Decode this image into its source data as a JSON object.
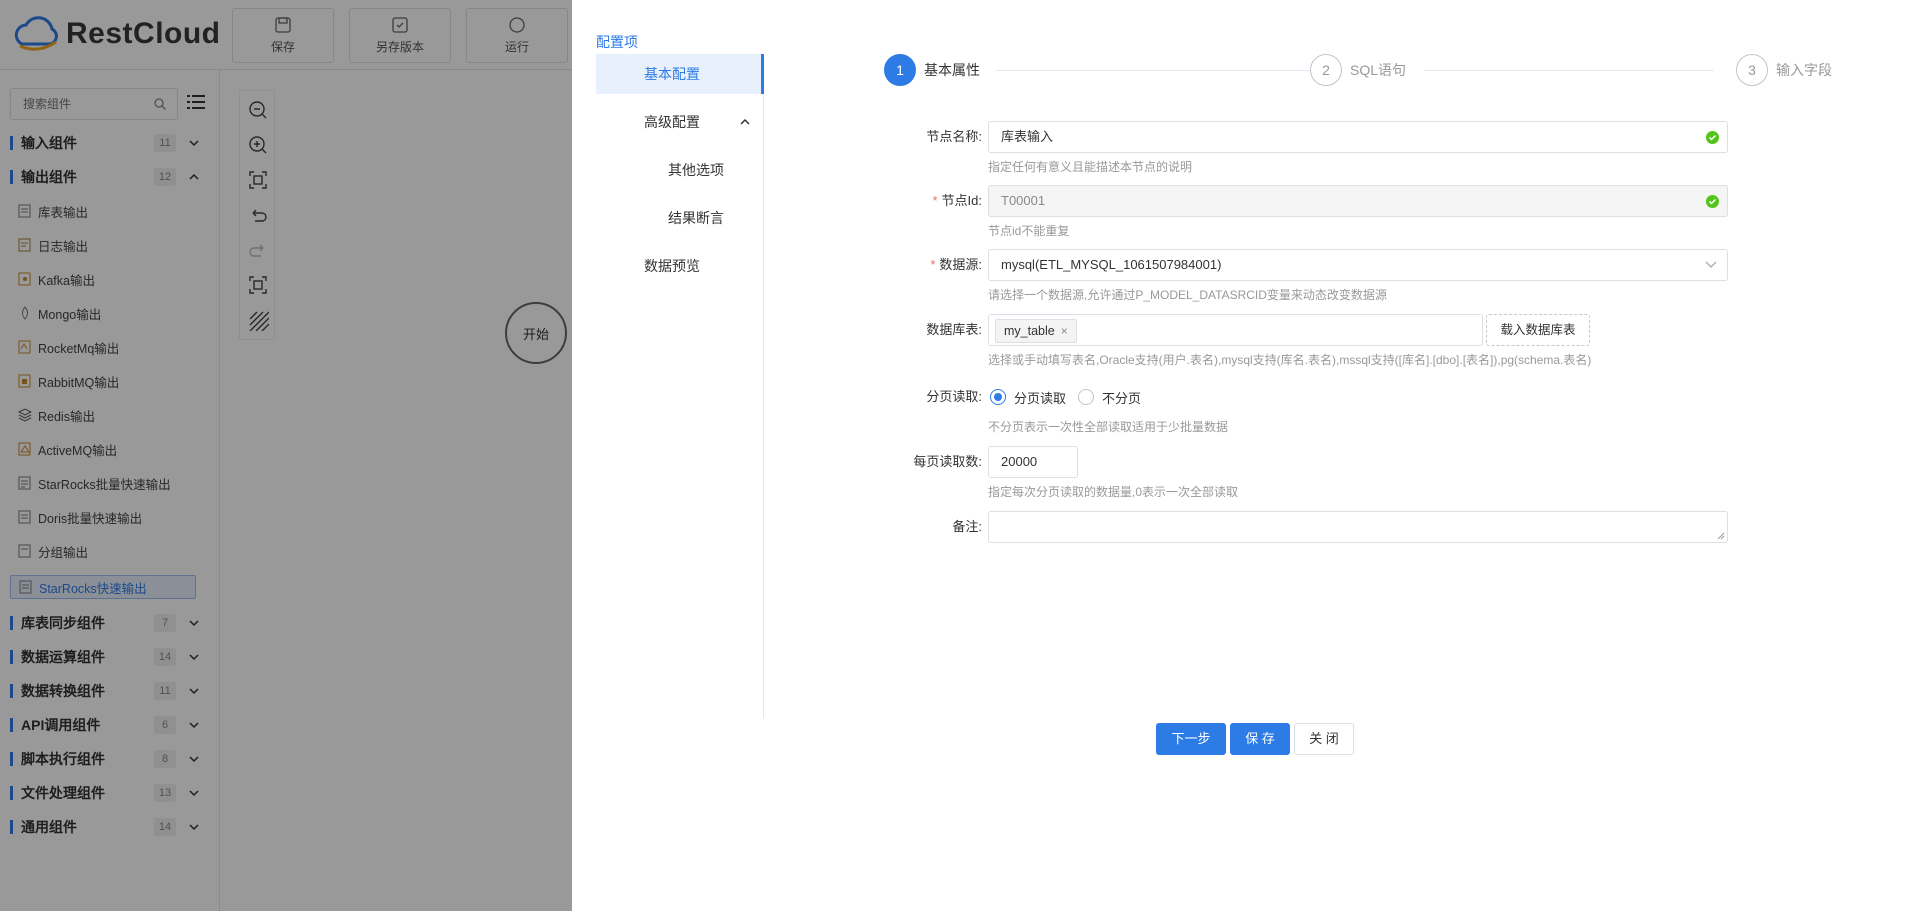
{
  "app": {
    "brand": "RestCloud",
    "toolbar": [
      {
        "label": "保存",
        "icon": "save-icon"
      },
      {
        "label": "另存版本",
        "icon": "save-as-icon"
      },
      {
        "label": "运行",
        "icon": "run-icon"
      }
    ]
  },
  "sidebar": {
    "search_placeholder": "搜索组件",
    "categories": [
      {
        "name": "输入组件",
        "count": "11",
        "expanded": false
      },
      {
        "name": "输出组件",
        "count": "12",
        "expanded": true
      },
      {
        "name": "库表同步组件",
        "count": "7",
        "expanded": false
      },
      {
        "name": "数据运算组件",
        "count": "14",
        "expanded": false
      },
      {
        "name": "数据转换组件",
        "count": "11",
        "expanded": false
      },
      {
        "name": "API调用组件",
        "count": "6",
        "expanded": false
      },
      {
        "name": "脚本执行组件",
        "count": "8",
        "expanded": false
      },
      {
        "name": "文件处理组件",
        "count": "13",
        "expanded": false
      },
      {
        "name": "通用组件",
        "count": "14",
        "expanded": false
      }
    ],
    "output_items": [
      "库表输出",
      "日志输出",
      "Kafka输出",
      "Mongo输出",
      "RocketMq输出",
      "RabbitMQ输出",
      "Redis输出",
      "ActiveMQ输出",
      "StarRocks批量快速输出",
      "Doris批量快速输出",
      "分组输出",
      "StarRocks快速输出"
    ],
    "active_item": "StarRocks快速输出"
  },
  "canvas": {
    "start_node": "开始"
  },
  "drawer": {
    "title": "配置项",
    "nav": [
      {
        "label": "基本配置",
        "active": true
      },
      {
        "label": "高级配置",
        "active": false
      },
      {
        "label": "其他选项",
        "active": false
      },
      {
        "label": "结果断言",
        "active": false
      },
      {
        "label": "数据预览",
        "active": false
      }
    ],
    "steps": [
      {
        "num": "1",
        "label": "基本属性",
        "active": true
      },
      {
        "num": "2",
        "label": "SQL语句",
        "active": false
      },
      {
        "num": "3",
        "label": "输入字段",
        "active": false
      }
    ],
    "form": {
      "node_name": {
        "label": "节点名称:",
        "value": "库表输入",
        "help": "指定任何有意义且能描述本节点的说明"
      },
      "node_id": {
        "label": "节点Id:",
        "value": "T00001",
        "help": "节点id不能重复"
      },
      "datasource": {
        "label": "数据源:",
        "value": "mysql(ETL_MYSQL_1061507984001)",
        "help": "请选择一个数据源,允许通过P_MODEL_DATASRCID变量来动态改变数据源"
      },
      "table": {
        "label": "数据库表:",
        "tag": "my_table",
        "tag_close": "×",
        "load_button": "载入数据库表",
        "help": "选择或手动填写表名,Oracle支持(用户.表名),mysql支持(库名.表名),mssql支持([库名].[dbo].[表名]),pg(schema.表名)"
      },
      "paging": {
        "label": "分页读取:",
        "option_on": "分页读取",
        "option_off": "不分页",
        "selected": "分页读取",
        "help": "不分页表示一次性全部读取适用于少批量数据"
      },
      "page_size": {
        "label": "每页读取数:",
        "value": "20000",
        "help": "指定每次分页读取的数据量,0表示一次全部读取"
      },
      "remark": {
        "label": "备注:",
        "value": ""
      }
    },
    "buttons": {
      "next": "下一步",
      "save": "保 存",
      "close": "关 闭"
    }
  },
  "colors": {
    "primary": "#2d7be5",
    "success": "#52c41a",
    "required": "#f56c6c"
  }
}
